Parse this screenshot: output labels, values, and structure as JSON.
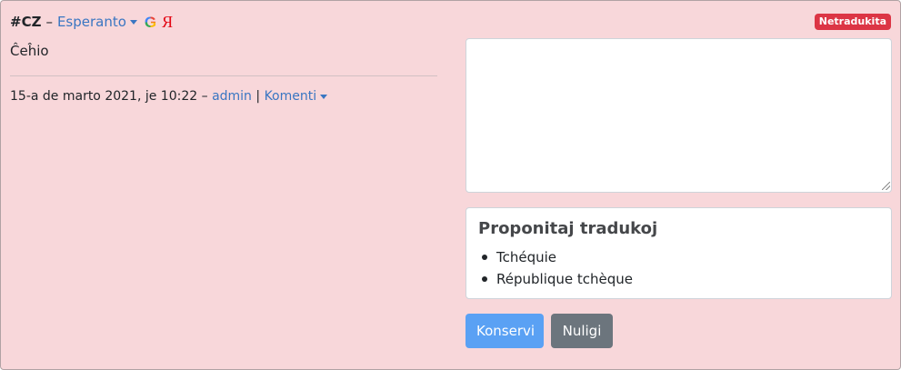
{
  "unit": {
    "id": "#CZ",
    "separator": "–",
    "language": "Esperanto",
    "google_icon": "G",
    "yandex_icon": "Я",
    "source_text": "Ĉeĥio",
    "date": "15-a de marto 2021, je 10:22",
    "date_separator": "–",
    "author": "admin",
    "bar": "|",
    "comments_label": "Komenti"
  },
  "status_badge": "Netradukita",
  "suggestions": {
    "title": "Proponitaj tradukoj",
    "items": [
      "Tchéquie",
      "République tchèque"
    ]
  },
  "buttons": {
    "save": "Konservi",
    "cancel": "Nuligi"
  },
  "colors": {
    "card_background": "#f8d7da",
    "badge": "#dc3545",
    "save_button": "#5aa1f4",
    "cancel_button": "#6c757d",
    "link": "#3a76c2"
  },
  "icons": [
    "google-translate-icon",
    "yandex-translate-icon",
    "caret-down-icon",
    "resize-grip-icon"
  ]
}
